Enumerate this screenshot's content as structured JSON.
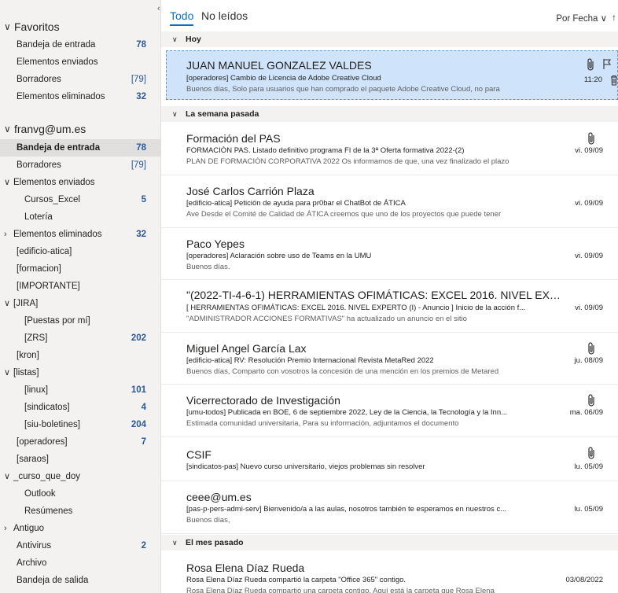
{
  "folders": {
    "favorites": {
      "label": "Favoritos",
      "items": [
        {
          "label": "Bandeja de entrada",
          "count": "78"
        },
        {
          "label": "Elementos enviados",
          "count": ""
        },
        {
          "label": "Borradores",
          "count": "[79]"
        },
        {
          "label": "Elementos eliminados",
          "count": "32"
        }
      ]
    },
    "account": {
      "label": "franvg@um.es",
      "items": [
        {
          "label": "Bandeja de entrada",
          "count": "78"
        },
        {
          "label": "Borradores",
          "count": "[79]"
        },
        {
          "label": "Elementos enviados",
          "count": ""
        },
        {
          "label": "Cursos_Excel",
          "count": "5"
        },
        {
          "label": "Lotería",
          "count": ""
        },
        {
          "label": "Elementos eliminados",
          "count": "32"
        },
        {
          "label": "[edificio-atica]",
          "count": ""
        },
        {
          "label": "[formacion]",
          "count": ""
        },
        {
          "label": "[IMPORTANTE]",
          "count": ""
        },
        {
          "label": "[JIRA]",
          "count": ""
        },
        {
          "label": "[Puestas por mí]",
          "count": ""
        },
        {
          "label": "[ZRS]",
          "count": "202"
        },
        {
          "label": "[kron]",
          "count": ""
        },
        {
          "label": "[listas]",
          "count": ""
        },
        {
          "label": "[linux]",
          "count": "101"
        },
        {
          "label": "[sindicatos]",
          "count": "4"
        },
        {
          "label": "[siu-boletines]",
          "count": "204"
        },
        {
          "label": "[operadores]",
          "count": "7"
        },
        {
          "label": "[saraos]",
          "count": ""
        },
        {
          "label": "_curso_que_doy",
          "count": ""
        },
        {
          "label": "Outlook",
          "count": ""
        },
        {
          "label": "Resúmenes",
          "count": ""
        },
        {
          "label": "Antiguo",
          "count": ""
        },
        {
          "label": "Antivirus",
          "count": "2"
        },
        {
          "label": "Archivo",
          "count": ""
        },
        {
          "label": "Bandeja de salida",
          "count": ""
        }
      ]
    }
  },
  "list": {
    "tabs": [
      "Todo",
      "No leídos"
    ],
    "sort_label": "Por Fecha",
    "groups": [
      "Hoy",
      "La semana pasada",
      "El mes pasado"
    ],
    "messages": [
      {
        "sender": "JUAN MANUEL GONZALEZ VALDES",
        "subject": "[operadores] Cambio de Licencia de Adobe Creative Cloud",
        "preview": "Buenos días,  Solo para usuarios que han comprado el paquete Adobe Creative Cloud, no para",
        "date": "11:20"
      },
      {
        "sender": "Formación del PAS",
        "subject": "FORMACIÓN PAS. Listado definitivo programa FI de la 3ª Oferta formativa 2022-(2)",
        "preview": "PLAN DE FORMACIÓN CORPORATIVA 2022  Os informamos de que, una vez finalizado el plazo",
        "date": "vi. 09/09"
      },
      {
        "sender": "José Carlos Carrión Plaza",
        "subject": "[edificio-atica] Petición de ayuda para pr0bar el ChatBot de ÁTICA",
        "preview": "Ave  Desde el Comité de Calidad de ÁTICA creemos que uno de los proyectos que puede tener",
        "date": "vi. 09/09"
      },
      {
        "sender": "Paco Yepes",
        "subject": "[operadores] Aclaración sobre uso de Teams en la UMU",
        "preview": "Buenos días.",
        "date": "vi. 09/09"
      },
      {
        "sender": "\"(2022-TI-4-6-1) HERRAMIENTAS OFIMÁTICAS: EXCEL 2016. NIVEL EXPE...",
        "subject": "[ HERRAMIENTAS OFIMÁTICAS: EXCEL 2016. NIVEL EXPERTO (I) - Anuncio ] Inicio de la acción f...",
        "preview": "\"ADMINISTRADOR ACCIONES FORMATIVAS\" ha actualizado un anuncio en el sitio",
        "date": "vi. 09/09"
      },
      {
        "sender": "Miguel Angel García Lax",
        "subject": "[edificio-atica] RV: Resolución Premio Internacional Revista MetaRed 2022",
        "preview": "Buenos días,  Comparto con vosotros la concesión de una mención en los premios de Metared",
        "date": "ju. 08/09"
      },
      {
        "sender": "Vicerrectorado de Investigación",
        "subject": "[umu-todos] Publicada en BOE, 6 de septiembre 2022, Ley de la Ciencia, la Tecnología y la Inn...",
        "preview": "Estimada comunidad universitaria,  Para su información, adjuntamos el documento",
        "date": "ma. 06/09"
      },
      {
        "sender": "CSIF",
        "subject": "[sindicatos-pas] Nuevo curso universitario, viejos problemas sin resolver",
        "preview": "",
        "date": "lu. 05/09"
      },
      {
        "sender": "ceee@um.es",
        "subject": "[pas-p-pers-admi-serv] Bienvenido/a a las aulas, nosotros también te esperamos en nuestros c...",
        "preview": "Buenos días,",
        "date": "lu. 05/09"
      },
      {
        "sender": "Rosa Elena Díaz Rueda",
        "subject": "Rosa Elena Díaz Rueda compartió la carpeta \"Office 365\" contigo.",
        "preview": "Rosa Elena Díaz Rueda compartió una carpeta contigo.  Aquí está la carpeta que Rosa Elena",
        "date": "03/08/2022"
      }
    ]
  }
}
